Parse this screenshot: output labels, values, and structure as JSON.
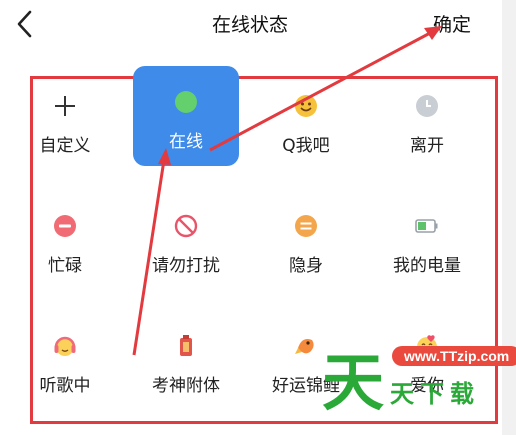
{
  "header": {
    "title": "在线状态",
    "confirm_label": "确定",
    "back_icon": "chevron-left-icon"
  },
  "statuses": [
    {
      "label": "自定义",
      "icon": "plus-icon"
    },
    {
      "label": "在线",
      "icon": "green-dot-icon",
      "selected": true
    },
    {
      "label": "Q我吧",
      "icon": "smiley-icon"
    },
    {
      "label": "离开",
      "icon": "clock-icon"
    },
    {
      "label": "忙碌",
      "icon": "busy-icon"
    },
    {
      "label": "请勿打扰",
      "icon": "do-not-disturb-icon"
    },
    {
      "label": "隐身",
      "icon": "invisible-icon"
    },
    {
      "label": "我的电量",
      "icon": "battery-icon"
    },
    {
      "label": "听歌中",
      "icon": "headphones-icon"
    },
    {
      "label": "考神附体",
      "icon": "exam-charm-icon"
    },
    {
      "label": "好运锦鲤",
      "icon": "koi-icon"
    },
    {
      "label": "爱你",
      "icon": "love-icon"
    }
  ],
  "watermark": {
    "big": "天",
    "url": "www.TTzip.com",
    "small": "天下载"
  },
  "colors": {
    "selected_bg": "#3e8bea",
    "online_green": "#63cf6d",
    "annotation_red": "#e23a3f",
    "watermark_green": "#2aa838"
  }
}
